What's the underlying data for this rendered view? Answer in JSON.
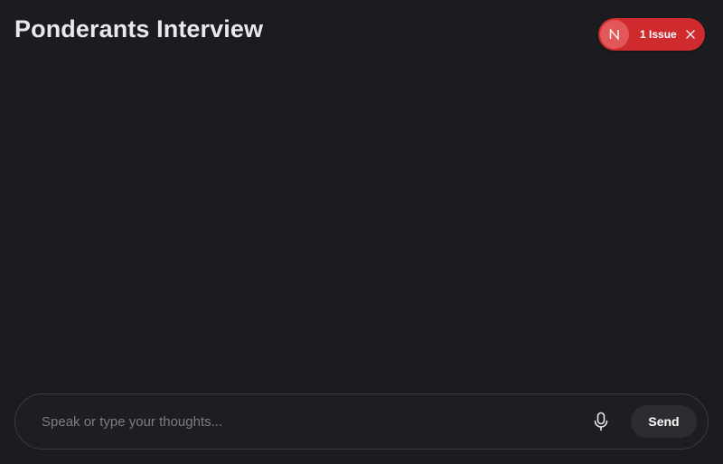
{
  "header": {
    "title": "Ponderants Interview"
  },
  "issue_badge": {
    "logo_letter": "N",
    "label": "1 Issue",
    "color": "#cf2b2e",
    "icons": [
      "nextjs-logo-icon",
      "close-icon"
    ]
  },
  "composer": {
    "placeholder": "Speak or type your thoughts...",
    "value": "",
    "mic_icon": "microphone-icon",
    "send_label": "Send"
  }
}
